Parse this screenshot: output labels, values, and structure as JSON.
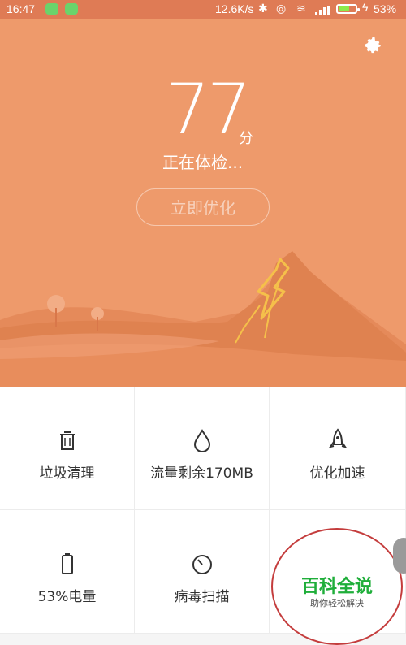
{
  "status_bar": {
    "time": "16:47",
    "net_speed": "12.6K/s",
    "battery_percent": "53%",
    "battery_level": 0.53
  },
  "header": {
    "score": "77",
    "score_unit": "分",
    "status_text": "正在体检...",
    "optimize_button": "立即优化"
  },
  "grid": [
    {
      "label": "垃圾清理",
      "icon": "trash-icon"
    },
    {
      "label": "流量剩余170MB",
      "icon": "droplet-icon"
    },
    {
      "label": "优化加速",
      "icon": "rocket-icon"
    },
    {
      "label": "53%电量",
      "icon": "battery-icon"
    },
    {
      "label": "病毒扫描",
      "icon": "clock-scan-icon"
    },
    {
      "label": "",
      "icon": "partially-hidden"
    }
  ],
  "watermark": {
    "title": "百科全说",
    "subtitle": "助你轻松解决"
  },
  "colors": {
    "hero": "#ee9a6b",
    "mountain": "#e0824f",
    "lightning": "#f5c04a",
    "watermark_green": "#1fae3a"
  }
}
